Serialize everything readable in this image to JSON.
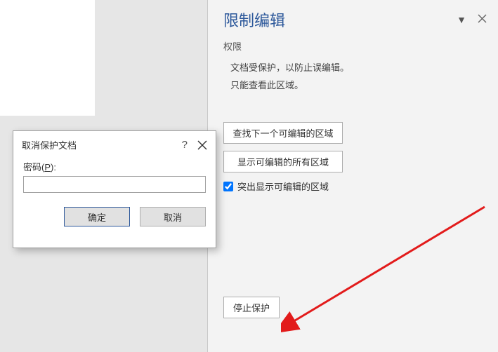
{
  "panel": {
    "title": "限制编辑",
    "section_label": "权限",
    "info_line1": "文档受保护，以防止误编辑。",
    "info_line2": "只能查看此区域。",
    "find_next_btn": "查找下一个可编辑的区域",
    "show_all_btn": "显示可编辑的所有区域",
    "highlight_checkbox": "突出显示可编辑的区域",
    "stop_protection_btn": "停止保护"
  },
  "dialog": {
    "title": "取消保护文档",
    "help": "?",
    "password_label_prefix": "密码(",
    "password_label_key": "P",
    "password_label_suffix": "):",
    "ok": "确定",
    "cancel": "取消"
  }
}
